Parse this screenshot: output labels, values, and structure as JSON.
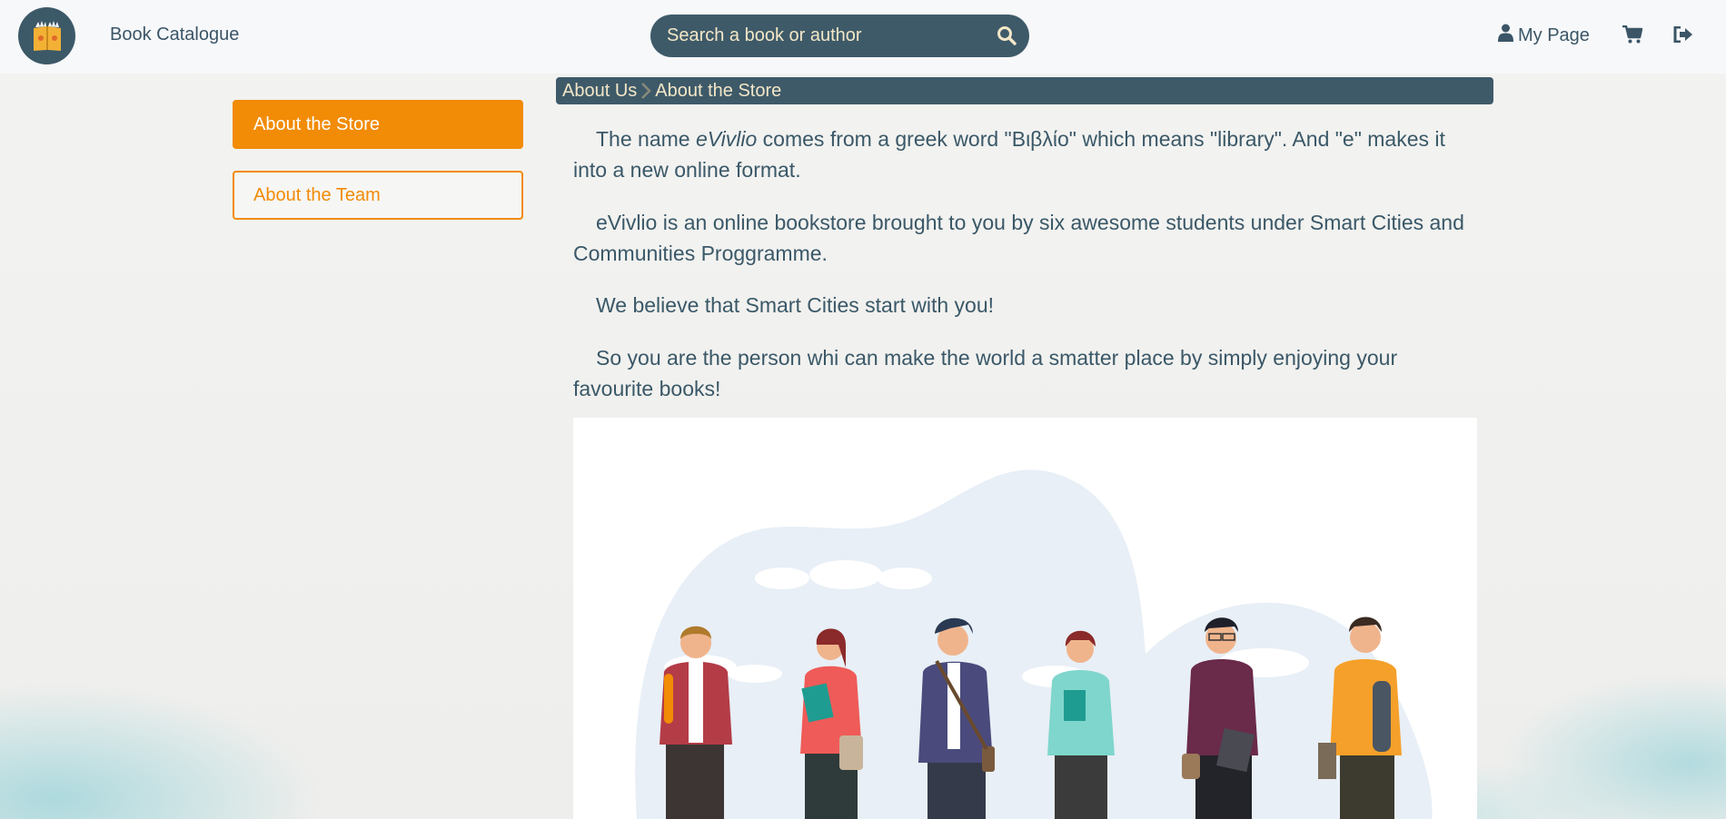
{
  "header": {
    "brand_label": "Book Catalogue",
    "search": {
      "placeholder": "Search a book or author"
    },
    "my_page_label": "My Page"
  },
  "sidebar": {
    "items": [
      {
        "label": "About the Store",
        "active": true
      },
      {
        "label": "About the Team",
        "active": false
      }
    ]
  },
  "breadcrumb": {
    "items": [
      "About Us",
      "About the Store"
    ]
  },
  "content": {
    "paragraph1": {
      "before": "The name ",
      "emphasis": "eVivlio",
      "after": " comes from a greek word \"Βιβλίο\" which means \"library\". And \"e\" makes it into a new online format."
    },
    "paragraph2": "eVivlio is an online bookstore brought to you by six awesome students under Smart Cities and Communities Proggramme.",
    "paragraph3": "We believe that Smart Cities start with you!",
    "paragraph4": "So you are the person whi can make the world a smatter place by simply enjoying your favourite books!"
  },
  "colors": {
    "primary_dark": "#3e5a69",
    "accent_orange": "#f28b05",
    "cream_text": "#f3e7c7",
    "body_text": "#3a5868"
  },
  "icons": {
    "logo": "book-logo-icon",
    "search": "search-icon",
    "user": "user-icon",
    "cart": "cart-icon",
    "logout": "logout-icon",
    "breadcrumb_separator": "chevron-right-icon"
  }
}
